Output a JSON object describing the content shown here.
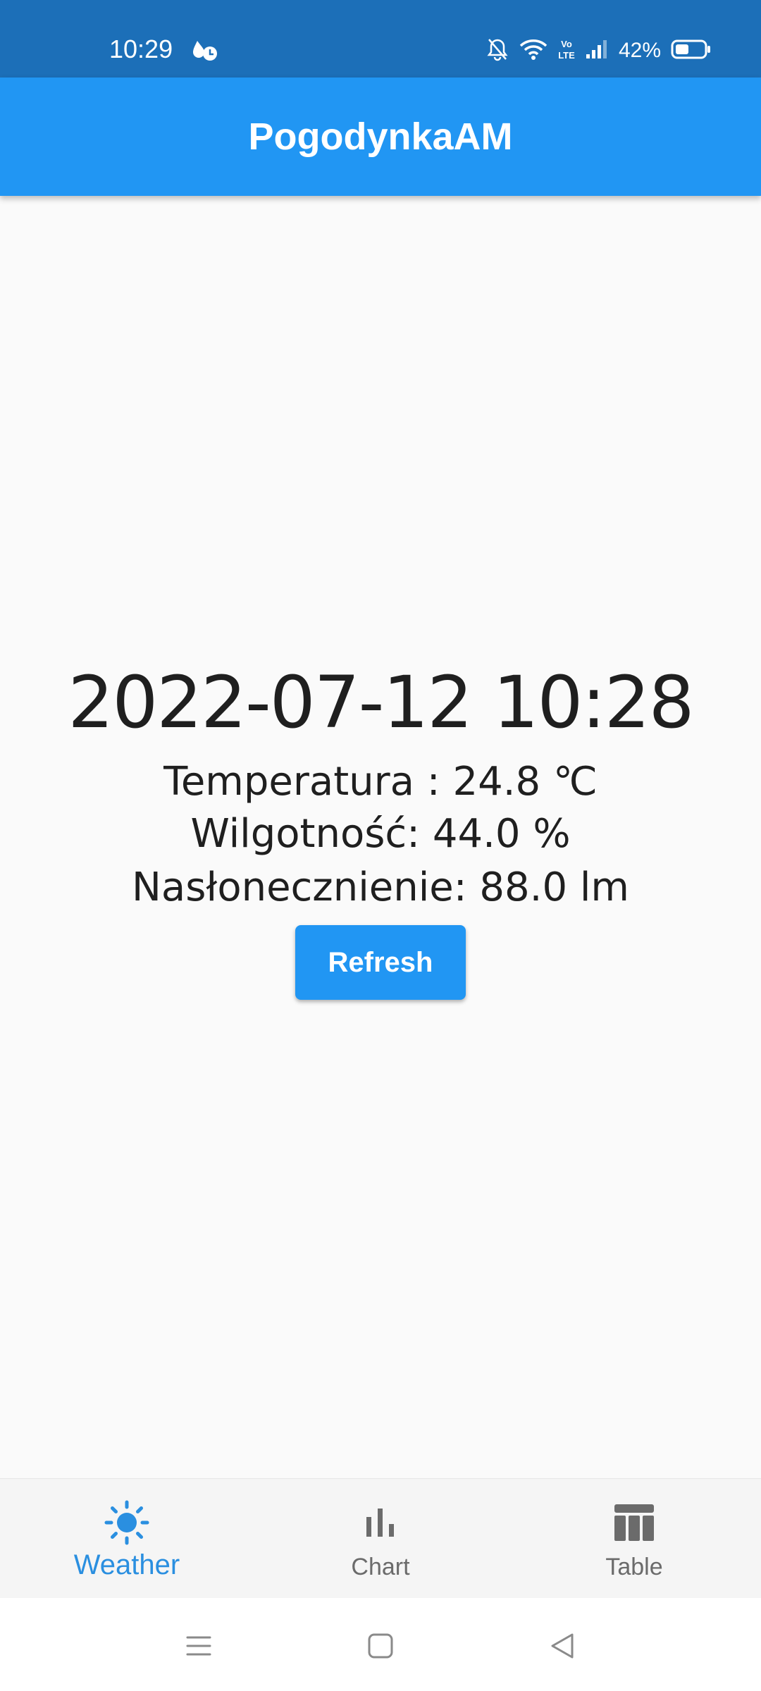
{
  "status_bar": {
    "time": "10:29",
    "battery_percent": "42%",
    "icons": [
      "notification-icon",
      "mute-icon",
      "wifi-icon",
      "volte-icon",
      "signal-icon",
      "battery-icon"
    ],
    "background": "#1c6fb8"
  },
  "app_bar": {
    "title": "PogodynkaAM",
    "background": "#2196f3"
  },
  "weather": {
    "datetime": "2022-07-12 10:28",
    "temperature": "Temperatura : 24.8 ℃",
    "humidity": "Wilgotność: 44.0 %",
    "insolation": "Nasłonecznienie: 88.0 lm",
    "refresh_label": "Refresh"
  },
  "bottom_nav": {
    "items": [
      {
        "label": "Weather",
        "icon": "sun-icon",
        "active": true
      },
      {
        "label": "Chart",
        "icon": "bar-chart-icon",
        "active": false
      },
      {
        "label": "Table",
        "icon": "table-icon",
        "active": false
      }
    ],
    "active_color": "#2a8fe0",
    "inactive_color": "#6b6b6b"
  },
  "system_nav": {
    "buttons": [
      "menu-icon",
      "home-icon",
      "back-icon"
    ]
  }
}
